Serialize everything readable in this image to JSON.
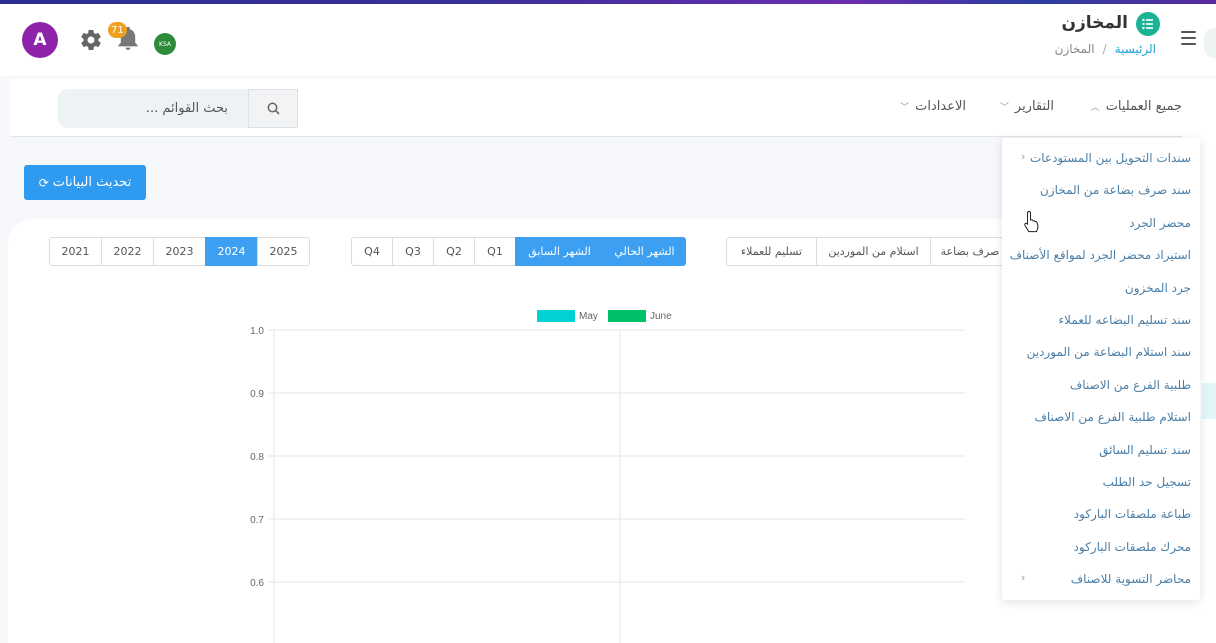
{
  "header": {
    "title": "المخازن",
    "breadcrumb": {
      "home": "الرئيسية",
      "separator": "/",
      "current": "المخازن"
    },
    "user_initial": "A",
    "notification_count": "71",
    "flag_label": "KSA"
  },
  "nav": {
    "all_operations": "جميع العمليات",
    "reports": "التقارير",
    "settings": "الاعدادات",
    "search_placeholder": "بحث القوائم ..."
  },
  "refresh_button": "تحديث البيانات",
  "year_buttons": [
    "2021",
    "2022",
    "2023",
    "2024",
    "2025"
  ],
  "active_year": "2024",
  "period_buttons": [
    "Q4",
    "Q3",
    "Q2",
    "Q1",
    "الشهر السابق",
    "الشهر الحالي"
  ],
  "type_buttons": [
    "تسليم للعملاء",
    "استلام من الموردين",
    "صرف بضاعة"
  ],
  "dropdown": {
    "items": [
      "سندات التحويل بين المستودعات",
      "سند صرف بضاعة من المخازن",
      "محضر الجرد",
      "استيراد محضر الجرد لمواقع الأصناف",
      "جرد المخزون",
      "سند تسليم البضاعه للعملاء",
      "سند استلام البضاعة من الموردين",
      "طلبية الفرع من الاصناف",
      "استلام طلبية الفرع من الاصناف",
      "سند تسليم السائق",
      "تسجيل حد الطلب",
      "طباعة ملصقات الباركود",
      "محرك ملصقات الباركود",
      "محاضر التسوية للاصناف"
    ]
  },
  "colors": {
    "accent": "#3d9ff2",
    "teal": "#1ab394",
    "may": "#00d2d3",
    "june": "#00c06a"
  },
  "chart_data": {
    "type": "bar",
    "categories": [
      "May",
      "June"
    ],
    "series": [
      {
        "name": "May",
        "values": []
      },
      {
        "name": "June",
        "values": []
      }
    ],
    "y_ticks": [
      "1.0",
      "0.9",
      "0.8",
      "0.7",
      "0.6"
    ],
    "ylim": [
      0.6,
      1.0
    ],
    "grid": true,
    "legend": "top"
  }
}
